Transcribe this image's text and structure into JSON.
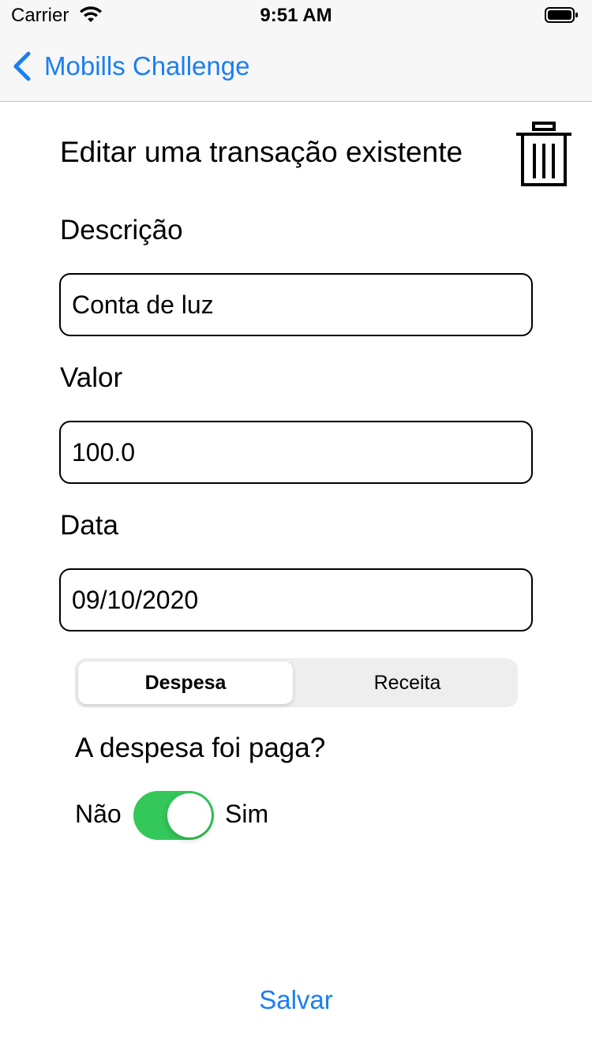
{
  "status_bar": {
    "carrier": "Carrier",
    "time": "9:51 AM"
  },
  "nav": {
    "back_label": "Mobills Challenge"
  },
  "form": {
    "title": "Editar uma transação existente",
    "description_label": "Descrição",
    "description_value": "Conta de luz",
    "value_label": "Valor",
    "value_value": "100.0",
    "date_label": "Data",
    "date_value": "09/10/2020",
    "segments": [
      "Despesa",
      "Receita"
    ],
    "selected_segment": "Despesa",
    "paid_question": "A despesa foi paga?",
    "toggle_off_label": "Não",
    "toggle_on_label": "Sim",
    "paid": true,
    "save_label": "Salvar"
  },
  "colors": {
    "accent": "#1a7ef5",
    "switch_on": "#34c759"
  }
}
